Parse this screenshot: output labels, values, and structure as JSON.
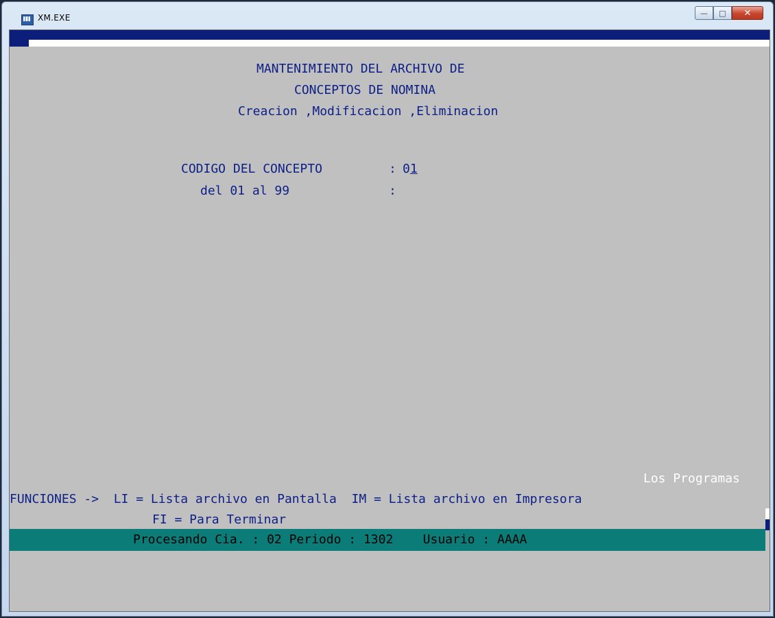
{
  "window": {
    "title": "XM.EXE",
    "icon": "dos-app-icon",
    "buttons": [
      "minimize-icon",
      "maximize-icon",
      "close-icon"
    ]
  },
  "screen": {
    "header": {
      "line1": "MANTENIMIENTO DEL ARCHIVO DE",
      "line2": "CONCEPTOS DE NOMINA",
      "line3": "Creacion ,Modificacion ,Eliminacion"
    },
    "field": {
      "label": "CODIGO DEL CONCEPTO",
      "separator": ":",
      "value_prefix": "0",
      "value_cursor": "1",
      "hint": "del 01 al 99",
      "hint_separator": ":"
    },
    "footer": {
      "programs": "Los Programas",
      "functions_line1": "FUNCIONES ->  LI = Lista archivo en Pantalla  IM = Lista archivo en Impresora",
      "functions_line2": "FI = Para Terminar"
    },
    "status_bar": {
      "text": "Procesando Cia. : 02 Periodo : 1302    Usuario : AAAA"
    }
  },
  "colors": {
    "background": "#c0c0c0",
    "text": "#0c1f86",
    "status_bar": "#0c7c78",
    "top_bar": "#0b1f7a"
  }
}
